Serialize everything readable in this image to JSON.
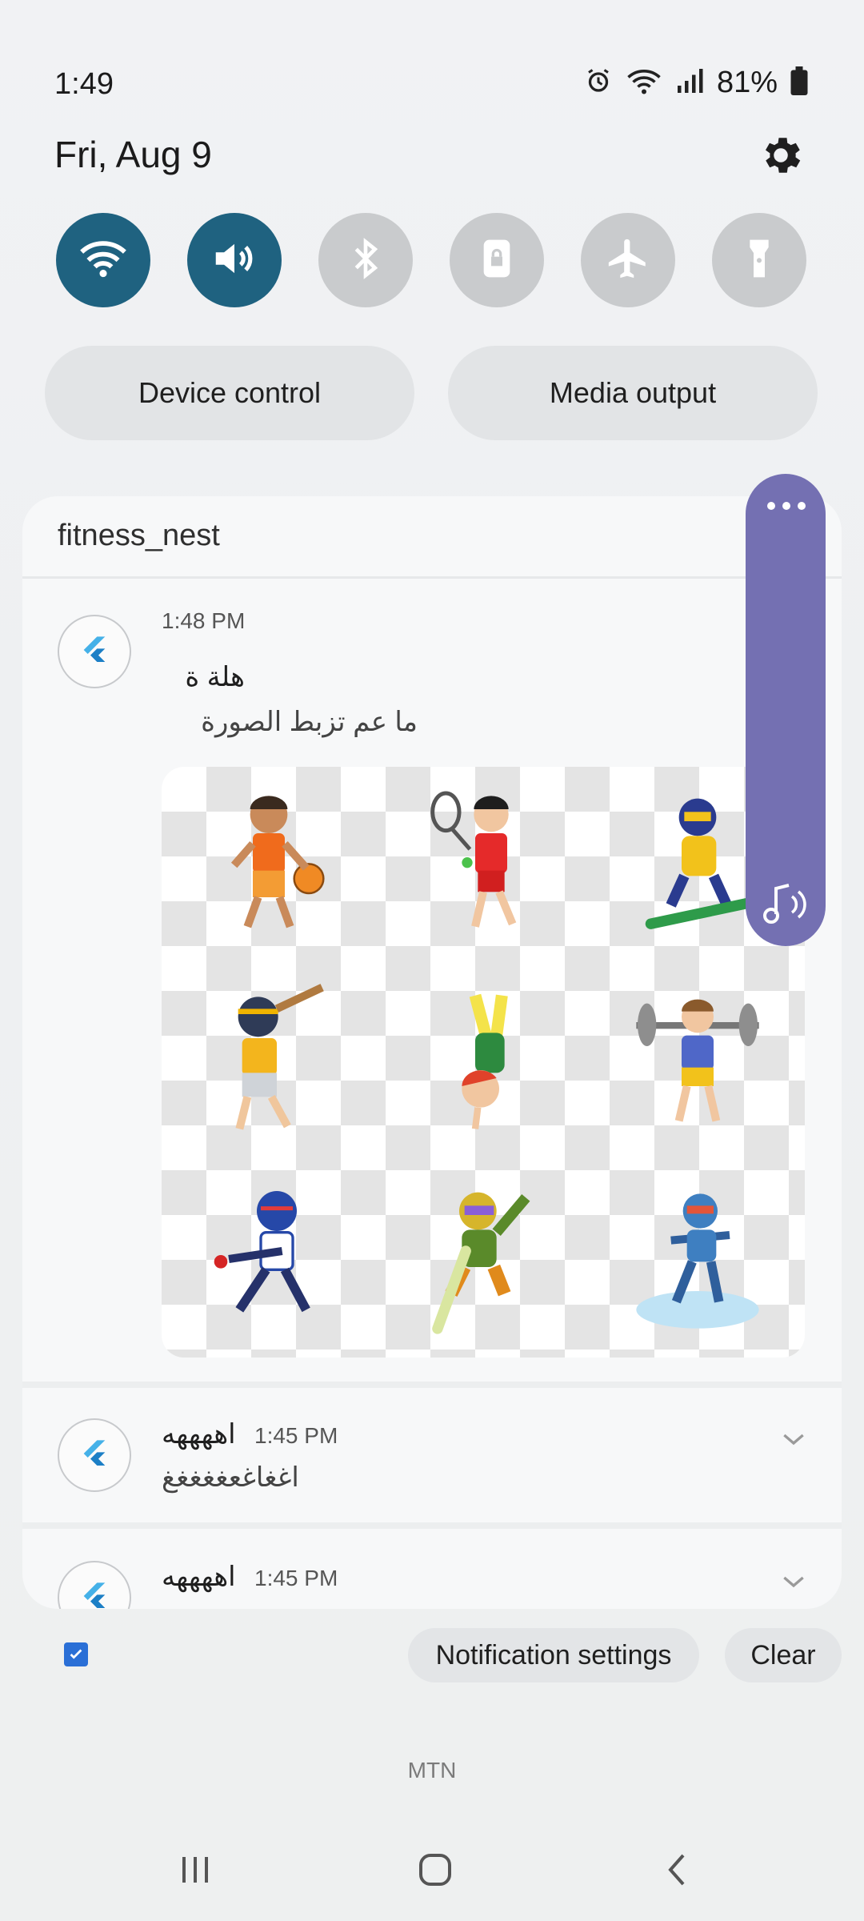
{
  "status_bar": {
    "time": "1:49",
    "battery": "81%",
    "icons": [
      "alarm-icon",
      "wifi-icon",
      "signal-icon",
      "battery-icon"
    ]
  },
  "header": {
    "date": "Fri, Aug 9"
  },
  "quick_toggles": [
    {
      "name": "wifi",
      "state": "on"
    },
    {
      "name": "sound",
      "state": "on"
    },
    {
      "name": "bluetooth",
      "state": "off"
    },
    {
      "name": "rotation-lock",
      "state": "off"
    },
    {
      "name": "airplane-mode",
      "state": "off"
    },
    {
      "name": "flashlight",
      "state": "off"
    }
  ],
  "controls": {
    "device_control": "Device control",
    "media_output": "Media output"
  },
  "notification_group": {
    "app": "fitness_nest",
    "items": [
      {
        "time": "1:48 PM",
        "title": "هلة ة",
        "text": "ما عم تزبط الصورة",
        "has_image": true
      },
      {
        "title": "اههههه",
        "time": "1:45 PM",
        "text": "اغغاغعغغغغغ"
      },
      {
        "title": "اههههه",
        "time": "1:45 PM",
        "text": ""
      }
    ]
  },
  "footer": {
    "notification_settings": "Notification settings",
    "clear": "Clear",
    "carrier": "MTN"
  },
  "colors": {
    "toggle_on": "#1f6280",
    "toggle_off": "#c9cbcd",
    "side_bubble": "#7470b2"
  }
}
